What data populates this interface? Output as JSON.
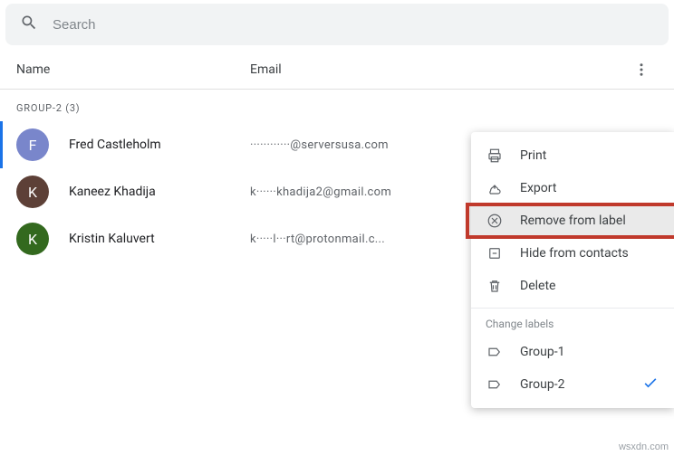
{
  "search": {
    "placeholder": "Search"
  },
  "headers": {
    "name": "Name",
    "email": "Email"
  },
  "group": {
    "label": "GROUP-2 (3)"
  },
  "contacts": [
    {
      "initial": "F",
      "name": "Fred Castleholm",
      "email": "············@serversusa.com",
      "color": "#7986cb",
      "selected": true
    },
    {
      "initial": "K",
      "name": "Kaneez Khadija",
      "email": "k······khadija2@gmail.com",
      "color": "#5d4037",
      "selected": false
    },
    {
      "initial": "K",
      "name": "Kristin Kaluvert",
      "email": "k·····l···rt@protonmail.c...",
      "color": "#33691e",
      "selected": false
    }
  ],
  "menu": {
    "print": "Print",
    "export": "Export",
    "remove": "Remove from label",
    "hide": "Hide from contacts",
    "delete": "Delete",
    "section": "Change labels",
    "group1": "Group-1",
    "group2": "Group-2"
  },
  "watermark": "wsxdn.com"
}
